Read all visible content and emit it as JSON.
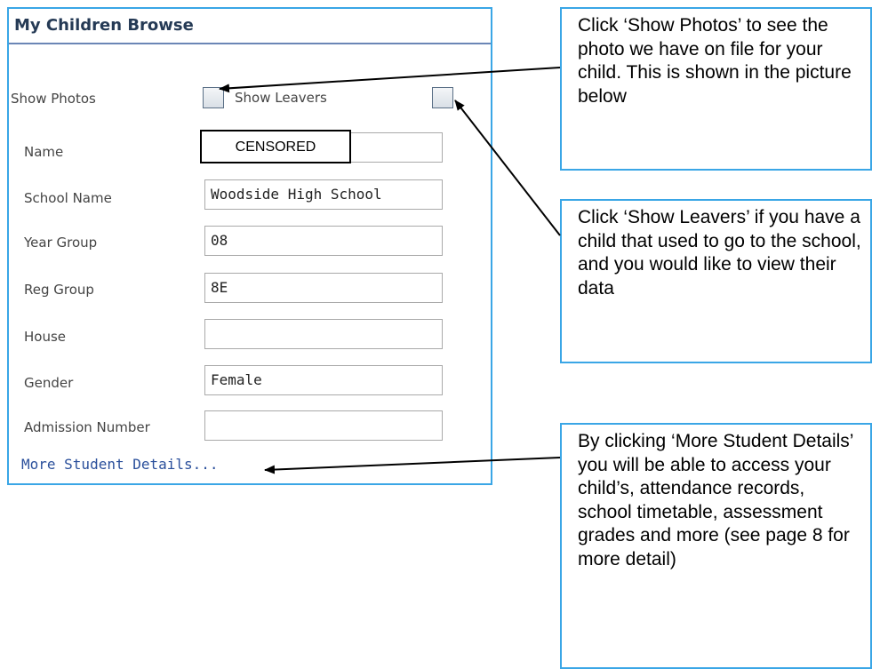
{
  "panel": {
    "title": "My Children Browse",
    "show_photos_label": "Show Photos",
    "show_leavers_label": "Show Leavers",
    "fields": [
      {
        "label": "Name",
        "value": ""
      },
      {
        "label": "School Name",
        "value": "Woodside High School"
      },
      {
        "label": "Year Group",
        "value": "08"
      },
      {
        "label": "Reg Group",
        "value": "8E"
      },
      {
        "label": "House",
        "value": ""
      },
      {
        "label": "Gender",
        "value": "Female"
      },
      {
        "label": "Admission Number",
        "value": ""
      }
    ],
    "more_link": "More Student Details...",
    "censor_text": "CENSORED"
  },
  "callouts": {
    "photos": "Click ‘Show Photos’ to see the photo we have on file for your child. This is shown in the picture below",
    "leavers": "Click ‘Show Leavers’ if you have a child that used to go to the school, and you would like to view their data",
    "details": "By clicking ‘More Student Details’ you will be able to access your child’s, attendance records, school timetable, assessment grades and more (see page 8 for more detail)"
  },
  "colors": {
    "border_accent": "#3aa6e6",
    "title_text": "#253a55",
    "link_text": "#2a4f9b"
  }
}
